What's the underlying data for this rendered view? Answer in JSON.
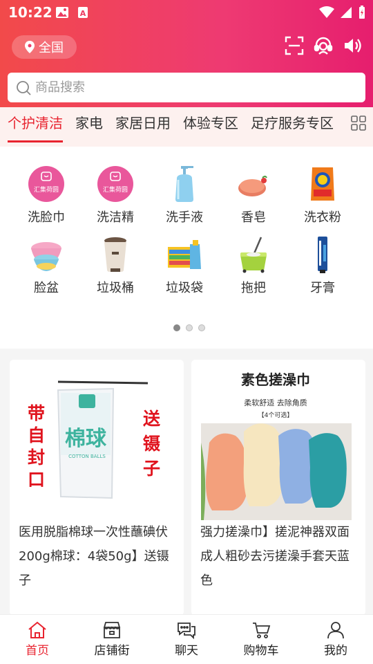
{
  "status": {
    "time": "10:22"
  },
  "header": {
    "location": "全国",
    "search_placeholder": "商品搜索"
  },
  "tabs": [
    {
      "label": "个护清洁"
    },
    {
      "label": "家电"
    },
    {
      "label": "家居日用"
    },
    {
      "label": "体验专区"
    },
    {
      "label": "足疗服务专区"
    }
  ],
  "categories": [
    {
      "label": "洗脸巾",
      "icon": "towel-icon"
    },
    {
      "label": "洗洁精",
      "icon": "dish-soap-icon"
    },
    {
      "label": "洗手液",
      "icon": "hand-soap-icon"
    },
    {
      "label": "香皂",
      "icon": "soap-bar-icon"
    },
    {
      "label": "洗衣粉",
      "icon": "detergent-icon"
    },
    {
      "label": "脸盆",
      "icon": "basin-icon"
    },
    {
      "label": "垃圾桶",
      "icon": "trash-can-icon"
    },
    {
      "label": "垃圾袋",
      "icon": "trash-bag-icon"
    },
    {
      "label": "拖把",
      "icon": "mop-icon"
    },
    {
      "label": "牙膏",
      "icon": "toothpaste-icon"
    }
  ],
  "category_brand_text": "汇集荷圆",
  "pager": {
    "pages": 3,
    "active": 1
  },
  "products": [
    {
      "title": "医用脱脂棉球一次性蘸碘伏 200g棉球：4袋50g】送镊子",
      "image_text": {
        "left": "带自封口",
        "right": "送镊子",
        "bag": "棉球",
        "bag_sub": "COTTON BALLS"
      }
    },
    {
      "title": "强力搓澡巾】搓泥神器双面成人粗砂去污搓澡手套天蓝色",
      "image_text": {
        "headline": "素色搓澡巾",
        "sub": "柔软舒适 去除角质",
        "note": "【4个可选】"
      }
    }
  ],
  "bottom_nav": [
    {
      "label": "首页",
      "icon": "home-icon",
      "active": true
    },
    {
      "label": "店铺街",
      "icon": "store-icon",
      "active": false
    },
    {
      "label": "聊天",
      "icon": "chat-icon",
      "active": false
    },
    {
      "label": "购物车",
      "icon": "cart-icon",
      "active": false
    },
    {
      "label": "我的",
      "icon": "user-icon",
      "active": false
    }
  ],
  "colors": {
    "accent": "#e8232f",
    "header_start": "#f24a4a",
    "header_end": "#e61e6e"
  }
}
